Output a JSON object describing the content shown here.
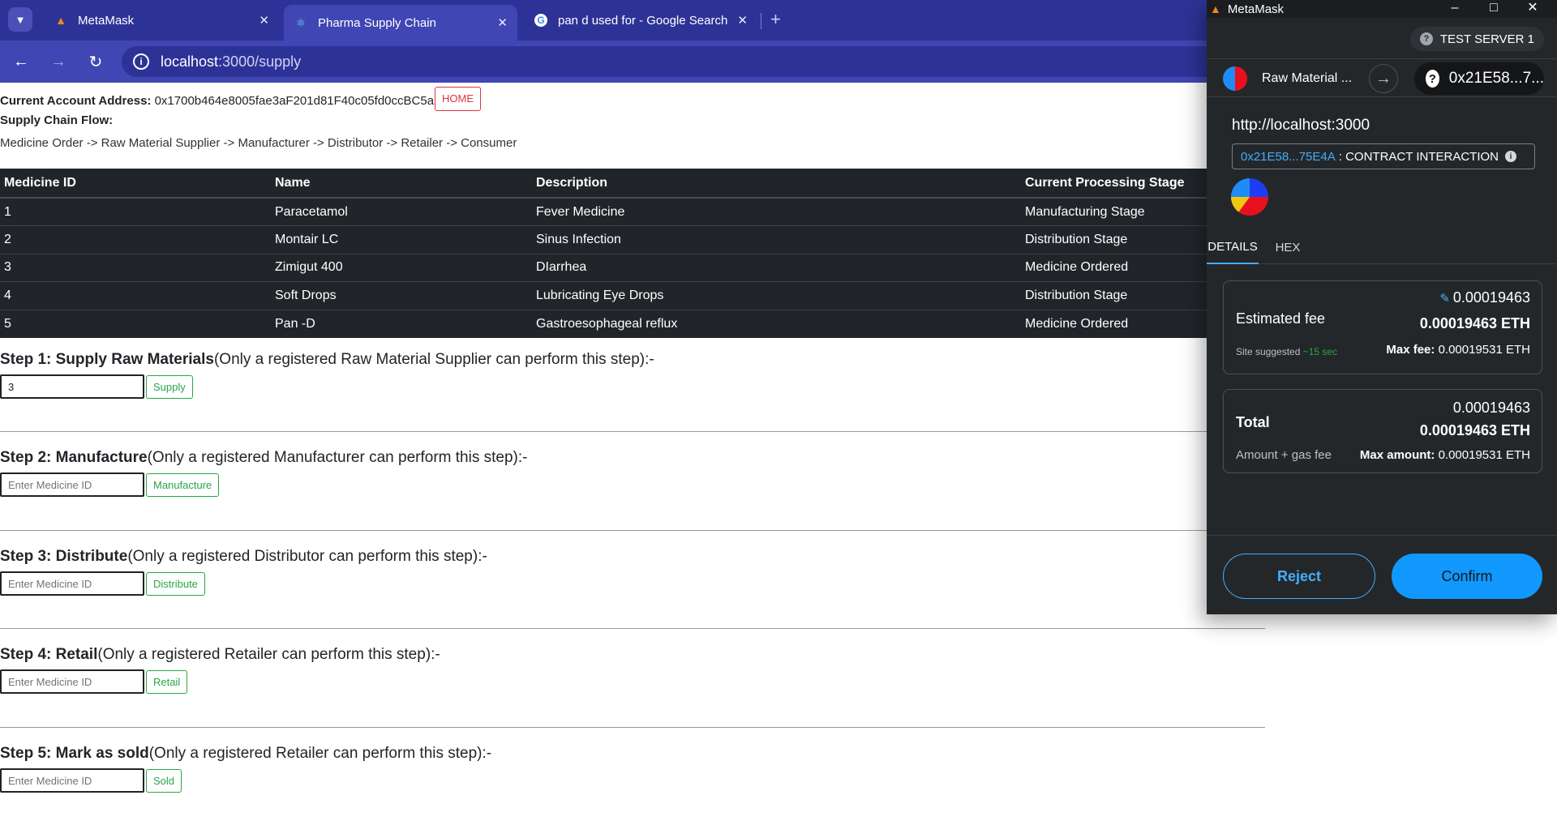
{
  "browser": {
    "tabs": [
      {
        "title": "MetaMask",
        "icon": "fox-icon"
      },
      {
        "title": "Pharma Supply Chain",
        "icon": "react-icon"
      },
      {
        "title": "pan d used for - Google Search",
        "icon": "google-icon"
      }
    ],
    "url_host": "localhost",
    "url_path": ":3000/supply"
  },
  "page": {
    "account_label": "Current Account Address:",
    "account_address": "0x1700b464e8005fae3aF201d81F40c05fd0ccBC5a",
    "home_button": "HOME",
    "flow_title": "Supply Chain Flow:",
    "flow_text": "Medicine Order -> Raw Material Supplier -> Manufacturer -> Distributor -> Retailer -> Consumer",
    "table": {
      "headers": [
        "Medicine ID",
        "Name",
        "Description",
        "Current Processing Stage"
      ],
      "rows": [
        [
          "1",
          "Paracetamol",
          "Fever Medicine",
          "Manufacturing Stage"
        ],
        [
          "2",
          "Montair LC",
          "Sinus Infection",
          "Distribution Stage"
        ],
        [
          "3",
          "Zimigut 400",
          "DIarrhea",
          "Medicine Ordered"
        ],
        [
          "4",
          "Soft Drops",
          "Lubricating Eye Drops",
          "Distribution Stage"
        ],
        [
          "5",
          "Pan -D",
          "Gastroesophageal reflux",
          "Medicine Ordered"
        ]
      ]
    },
    "steps": [
      {
        "title": "Step 1: Supply Raw Materials",
        "note": "(Only a registered Raw Material Supplier can perform this step):-",
        "value": "3",
        "placeholder": "Enter Medicine ID",
        "button": "Supply"
      },
      {
        "title": "Step 2: Manufacture",
        "note": "(Only a registered Manufacturer can perform this step):-",
        "value": "",
        "placeholder": "Enter Medicine ID",
        "button": "Manufacture"
      },
      {
        "title": "Step 3: Distribute",
        "note": "(Only a registered Distributor can perform this step):-",
        "value": "",
        "placeholder": "Enter Medicine ID",
        "button": "Distribute"
      },
      {
        "title": "Step 4: Retail",
        "note": "(Only a registered Retailer can perform this step):-",
        "value": "",
        "placeholder": "Enter Medicine ID",
        "button": "Retail"
      },
      {
        "title": "Step 5: Mark as sold",
        "note": "(Only a registered Retailer can perform this step):-",
        "value": "",
        "placeholder": "Enter Medicine ID",
        "button": "Sold"
      }
    ]
  },
  "metamask": {
    "window_title": "MetaMask",
    "network": "TEST SERVER 1",
    "from_account": "Raw Material ...",
    "to_account": "0x21E58...7...",
    "origin": "http://localhost:3000",
    "contract_address": "0x21E58...75E4A",
    "contract_label": ": CONTRACT INTERACTION",
    "tabs": [
      "DETAILS",
      "HEX"
    ],
    "estimated_fee_label": "Estimated fee",
    "estimated_fee": "0.00019463",
    "estimated_fee_eth": "0.00019463 ETH",
    "site_suggested": "Site suggested",
    "time_estimate": "~15 sec",
    "max_fee_label": "Max fee:",
    "max_fee": "0.00019531 ETH",
    "total_label": "Total",
    "total": "0.00019463",
    "total_eth": "0.00019463 ETH",
    "amount_gas_label": "Amount + gas fee",
    "max_amount_label": "Max amount:",
    "max_amount": "0.00019531 ETH",
    "reject_button": "Reject",
    "confirm_button": "Confirm"
  }
}
